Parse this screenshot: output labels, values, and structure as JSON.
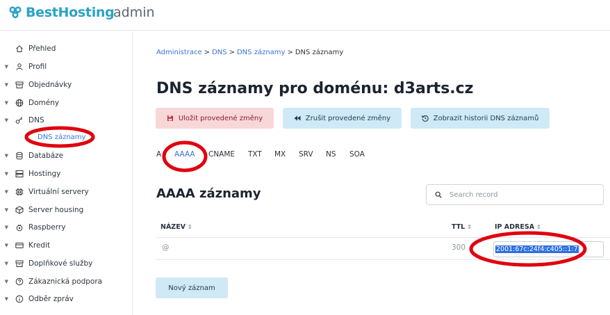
{
  "header": {
    "brand": "BestHosting",
    "suffix": "admin",
    "brand_color": "#2aa3c7"
  },
  "sidebar": {
    "items": [
      {
        "label": "Přehled",
        "icon": "home-icon",
        "caret": false
      },
      {
        "label": "Profil",
        "icon": "user-icon",
        "caret": true
      },
      {
        "label": "Objednávky",
        "icon": "archive-icon",
        "caret": true
      },
      {
        "label": "Domény",
        "icon": "globe-icon",
        "caret": true
      },
      {
        "label": "DNS",
        "icon": "key-icon",
        "caret": true
      },
      {
        "label": "Databáze",
        "icon": "database-icon",
        "caret": true
      },
      {
        "label": "Hostingy",
        "icon": "server-icon",
        "caret": true
      },
      {
        "label": "Virtuální servery",
        "icon": "cpu-icon",
        "caret": true
      },
      {
        "label": "Server housing",
        "icon": "box-icon",
        "caret": true
      },
      {
        "label": "Raspberry",
        "icon": "raspberry-icon",
        "caret": true
      },
      {
        "label": "Kredit",
        "icon": "credit-card-icon",
        "caret": true
      },
      {
        "label": "Doplňkové služby",
        "icon": "archive-icon",
        "caret": true
      },
      {
        "label": "Zákaznická podpora",
        "icon": "help-circle-icon",
        "caret": true
      },
      {
        "label": "Odběr zpráv",
        "icon": "info-circle-icon",
        "caret": true
      }
    ],
    "active_sub": "DNS záznamy"
  },
  "breadcrumb": {
    "items": [
      "Administrace",
      "DNS",
      "DNS záznamy"
    ],
    "current": "DNS záznamy",
    "separator": ">"
  },
  "page": {
    "title": "DNS záznamy pro doménu: d3arts.cz"
  },
  "actions": {
    "save": "Uložit provedené změny",
    "cancel": "Zrušit provedené změny",
    "history": "Zobrazit historii DNS záznamů"
  },
  "tabs": {
    "items": [
      "A",
      "AAAA",
      "CNAME",
      "TXT",
      "MX",
      "SRV",
      "NS",
      "SOA"
    ],
    "active": "AAAA"
  },
  "records": {
    "title": "AAAA záznamy",
    "search_placeholder": "Search record",
    "columns": {
      "name": "NÁZEV",
      "ttl": "TTL",
      "ip": "IP ADRESA"
    },
    "rows": [
      {
        "name": "@",
        "ttl": "300",
        "ip": "2001:67c:24f4:c405::1:7"
      }
    ],
    "new_button": "Nový záznam"
  },
  "colors": {
    "link": "#3a73d9",
    "danger_bg": "#f8d7d9",
    "info_bg": "#cfe9f7",
    "annotation": "#e0000f",
    "selection": "#2f6fde"
  }
}
